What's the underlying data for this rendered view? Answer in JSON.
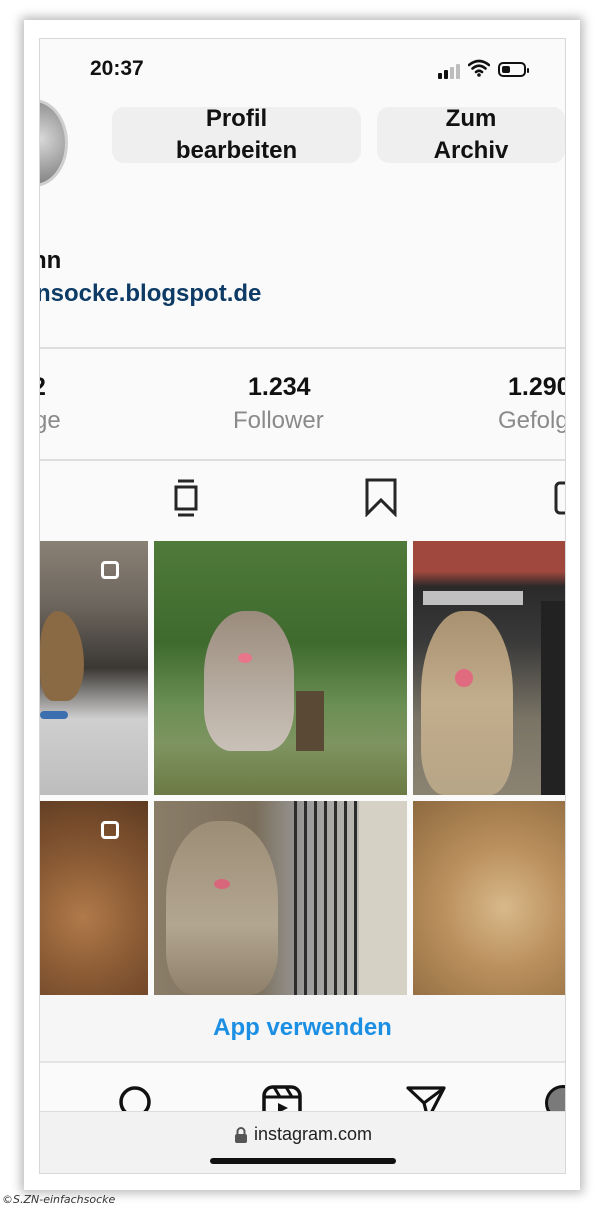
{
  "status_bar": {
    "time": "20:37"
  },
  "profile": {
    "edit_button": {
      "line1": "Profil",
      "line2": "bearbeiten"
    },
    "archive_button": {
      "line1": "Zum",
      "line2": "Archiv"
    },
    "name_partial": "nn",
    "website_partial": "nsocke.blogspot.de"
  },
  "stats": [
    {
      "value": "2",
      "label": "ge"
    },
    {
      "value": "1.234",
      "label": "Follower"
    },
    {
      "value": "1.290",
      "label": "Gefolg"
    }
  ],
  "tabs": [
    {
      "icon": "grid-icon"
    },
    {
      "icon": "guide-icon"
    },
    {
      "icon": "bookmark-icon"
    },
    {
      "icon": "tagged-icon"
    }
  ],
  "grid_photos": [
    {
      "subject": "dog in office",
      "multiple": true
    },
    {
      "subject": "bearded collie sitting under tree",
      "multiple": false
    },
    {
      "subject": "bearded collie in front of car",
      "multiple": false
    },
    {
      "subject": "dog fur close-up",
      "multiple": true
    },
    {
      "subject": "bearded collie near fence",
      "multiple": false
    },
    {
      "subject": "curly fur close-up",
      "multiple": false
    }
  ],
  "app_banner": {
    "label": "App verwenden"
  },
  "browser": {
    "url": "instagram.com"
  },
  "watermark": "©S.ZN-einfachsocke",
  "colors": {
    "accent_blue": "#1a8fe3",
    "link_blue": "#0d3b66",
    "button_bg": "#efefef",
    "muted_text": "#8a8a8a"
  }
}
